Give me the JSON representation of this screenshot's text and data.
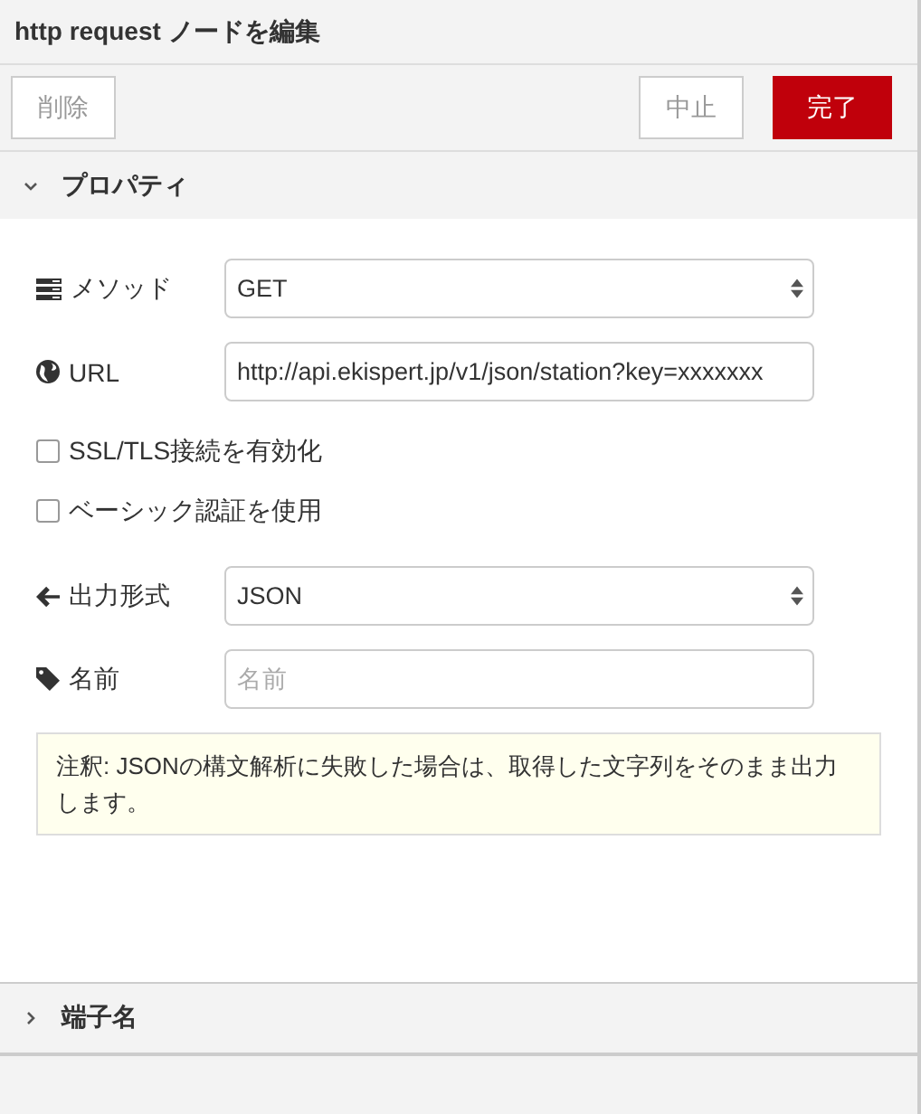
{
  "window": {
    "title": "http request ノードを編集"
  },
  "buttons": [
    {
      "label": "削除",
      "kind": "secondary"
    },
    {
      "label": "中止",
      "kind": "secondary"
    },
    {
      "label": "完了",
      "kind": "primary"
    }
  ],
  "properties": {
    "label": "プロパティ",
    "expanded": true,
    "fields": [
      {
        "kind": "select",
        "label": "メソッド",
        "value": "GET"
      },
      {
        "kind": "input",
        "label": "URL",
        "value": "http://api.ekispert.jp/v1/json/station?key=xxxxxxx"
      },
      {
        "kind": "checkbox",
        "label": "SSL/TLS接続を有効化",
        "checked": false
      },
      {
        "kind": "checkbox",
        "label": "ベーシック認証を使用",
        "checked": false
      },
      {
        "kind": "select",
        "label": "出力形式",
        "value": "JSON"
      },
      {
        "kind": "input",
        "label": "名前",
        "placeholder": "名前"
      }
    ],
    "note": "注釈: JSONの構文解析に失敗した場合は、取得した文字列をそのまま出力します。"
  },
  "ports_section": {
    "label": "端子名",
    "expanded": false
  }
}
